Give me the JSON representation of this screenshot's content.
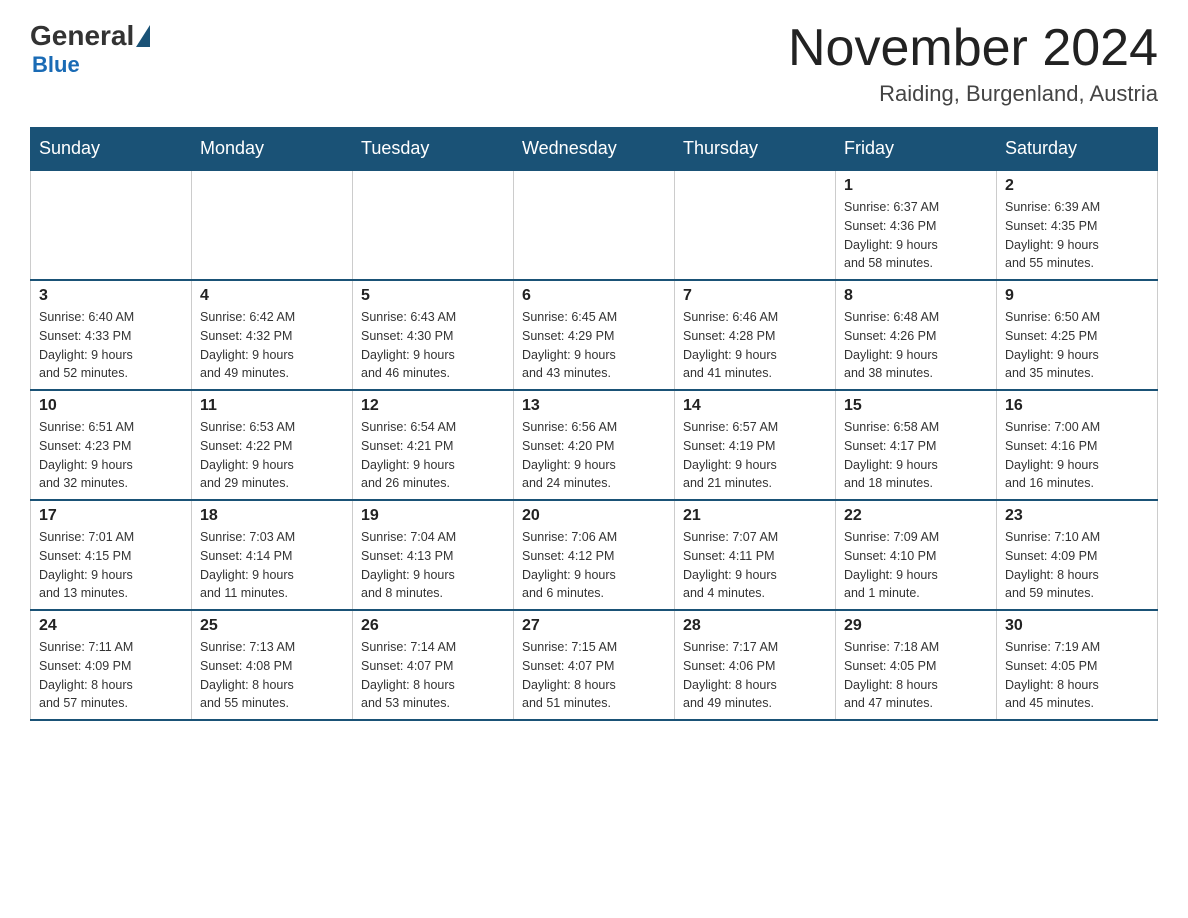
{
  "header": {
    "logo_general": "General",
    "logo_blue": "Blue",
    "month_title": "November 2024",
    "location": "Raiding, Burgenland, Austria"
  },
  "weekdays": [
    "Sunday",
    "Monday",
    "Tuesday",
    "Wednesday",
    "Thursday",
    "Friday",
    "Saturday"
  ],
  "weeks": [
    [
      {
        "day": "",
        "info": ""
      },
      {
        "day": "",
        "info": ""
      },
      {
        "day": "",
        "info": ""
      },
      {
        "day": "",
        "info": ""
      },
      {
        "day": "",
        "info": ""
      },
      {
        "day": "1",
        "info": "Sunrise: 6:37 AM\nSunset: 4:36 PM\nDaylight: 9 hours\nand 58 minutes."
      },
      {
        "day": "2",
        "info": "Sunrise: 6:39 AM\nSunset: 4:35 PM\nDaylight: 9 hours\nand 55 minutes."
      }
    ],
    [
      {
        "day": "3",
        "info": "Sunrise: 6:40 AM\nSunset: 4:33 PM\nDaylight: 9 hours\nand 52 minutes."
      },
      {
        "day": "4",
        "info": "Sunrise: 6:42 AM\nSunset: 4:32 PM\nDaylight: 9 hours\nand 49 minutes."
      },
      {
        "day": "5",
        "info": "Sunrise: 6:43 AM\nSunset: 4:30 PM\nDaylight: 9 hours\nand 46 minutes."
      },
      {
        "day": "6",
        "info": "Sunrise: 6:45 AM\nSunset: 4:29 PM\nDaylight: 9 hours\nand 43 minutes."
      },
      {
        "day": "7",
        "info": "Sunrise: 6:46 AM\nSunset: 4:28 PM\nDaylight: 9 hours\nand 41 minutes."
      },
      {
        "day": "8",
        "info": "Sunrise: 6:48 AM\nSunset: 4:26 PM\nDaylight: 9 hours\nand 38 minutes."
      },
      {
        "day": "9",
        "info": "Sunrise: 6:50 AM\nSunset: 4:25 PM\nDaylight: 9 hours\nand 35 minutes."
      }
    ],
    [
      {
        "day": "10",
        "info": "Sunrise: 6:51 AM\nSunset: 4:23 PM\nDaylight: 9 hours\nand 32 minutes."
      },
      {
        "day": "11",
        "info": "Sunrise: 6:53 AM\nSunset: 4:22 PM\nDaylight: 9 hours\nand 29 minutes."
      },
      {
        "day": "12",
        "info": "Sunrise: 6:54 AM\nSunset: 4:21 PM\nDaylight: 9 hours\nand 26 minutes."
      },
      {
        "day": "13",
        "info": "Sunrise: 6:56 AM\nSunset: 4:20 PM\nDaylight: 9 hours\nand 24 minutes."
      },
      {
        "day": "14",
        "info": "Sunrise: 6:57 AM\nSunset: 4:19 PM\nDaylight: 9 hours\nand 21 minutes."
      },
      {
        "day": "15",
        "info": "Sunrise: 6:58 AM\nSunset: 4:17 PM\nDaylight: 9 hours\nand 18 minutes."
      },
      {
        "day": "16",
        "info": "Sunrise: 7:00 AM\nSunset: 4:16 PM\nDaylight: 9 hours\nand 16 minutes."
      }
    ],
    [
      {
        "day": "17",
        "info": "Sunrise: 7:01 AM\nSunset: 4:15 PM\nDaylight: 9 hours\nand 13 minutes."
      },
      {
        "day": "18",
        "info": "Sunrise: 7:03 AM\nSunset: 4:14 PM\nDaylight: 9 hours\nand 11 minutes."
      },
      {
        "day": "19",
        "info": "Sunrise: 7:04 AM\nSunset: 4:13 PM\nDaylight: 9 hours\nand 8 minutes."
      },
      {
        "day": "20",
        "info": "Sunrise: 7:06 AM\nSunset: 4:12 PM\nDaylight: 9 hours\nand 6 minutes."
      },
      {
        "day": "21",
        "info": "Sunrise: 7:07 AM\nSunset: 4:11 PM\nDaylight: 9 hours\nand 4 minutes."
      },
      {
        "day": "22",
        "info": "Sunrise: 7:09 AM\nSunset: 4:10 PM\nDaylight: 9 hours\nand 1 minute."
      },
      {
        "day": "23",
        "info": "Sunrise: 7:10 AM\nSunset: 4:09 PM\nDaylight: 8 hours\nand 59 minutes."
      }
    ],
    [
      {
        "day": "24",
        "info": "Sunrise: 7:11 AM\nSunset: 4:09 PM\nDaylight: 8 hours\nand 57 minutes."
      },
      {
        "day": "25",
        "info": "Sunrise: 7:13 AM\nSunset: 4:08 PM\nDaylight: 8 hours\nand 55 minutes."
      },
      {
        "day": "26",
        "info": "Sunrise: 7:14 AM\nSunset: 4:07 PM\nDaylight: 8 hours\nand 53 minutes."
      },
      {
        "day": "27",
        "info": "Sunrise: 7:15 AM\nSunset: 4:07 PM\nDaylight: 8 hours\nand 51 minutes."
      },
      {
        "day": "28",
        "info": "Sunrise: 7:17 AM\nSunset: 4:06 PM\nDaylight: 8 hours\nand 49 minutes."
      },
      {
        "day": "29",
        "info": "Sunrise: 7:18 AM\nSunset: 4:05 PM\nDaylight: 8 hours\nand 47 minutes."
      },
      {
        "day": "30",
        "info": "Sunrise: 7:19 AM\nSunset: 4:05 PM\nDaylight: 8 hours\nand 45 minutes."
      }
    ]
  ]
}
